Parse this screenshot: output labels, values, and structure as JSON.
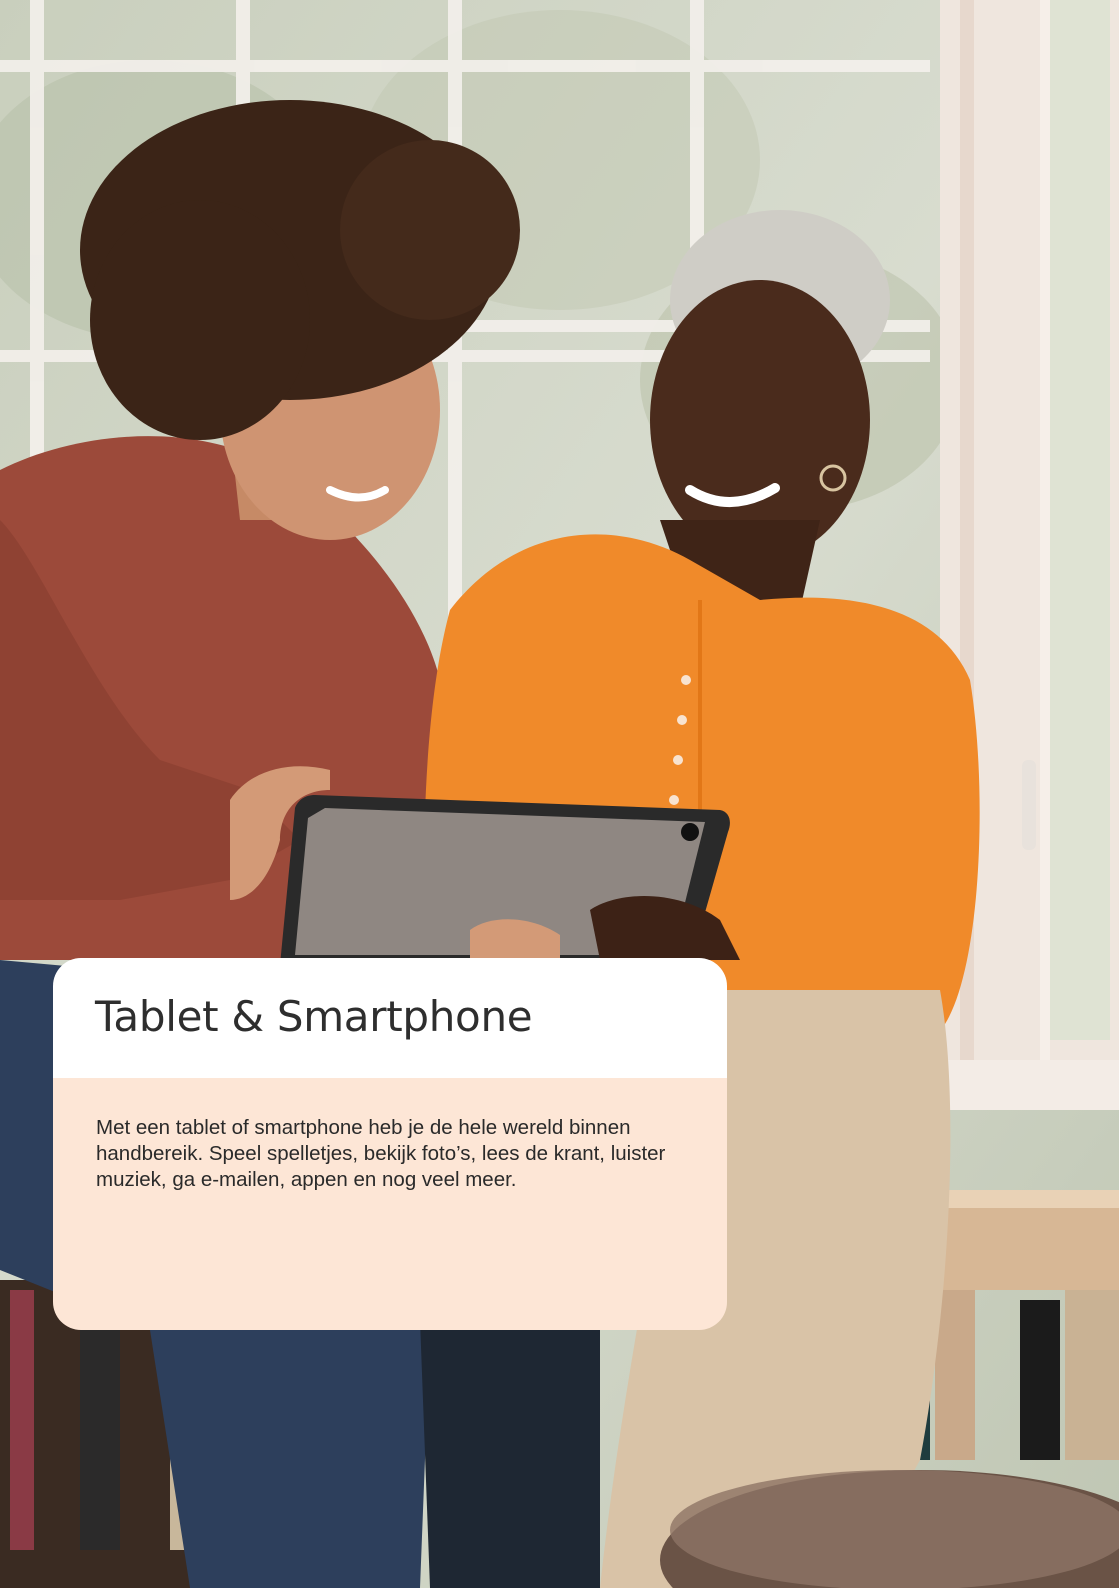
{
  "card": {
    "title": "Tablet & Smartphone",
    "text": "Met een tablet of smartphone heb je de hele wereld binnen handbereik. Speel spelletjes, bekijk foto’s, lees de krant, luister muziek, ga e-mailen, appen en nog veel meer."
  },
  "photo": {
    "icon": "photo-two-women-with-tablet"
  },
  "colors": {
    "card_header": "#ffffff",
    "card_body": "#fde6d6",
    "text": "#2a2a2a"
  }
}
